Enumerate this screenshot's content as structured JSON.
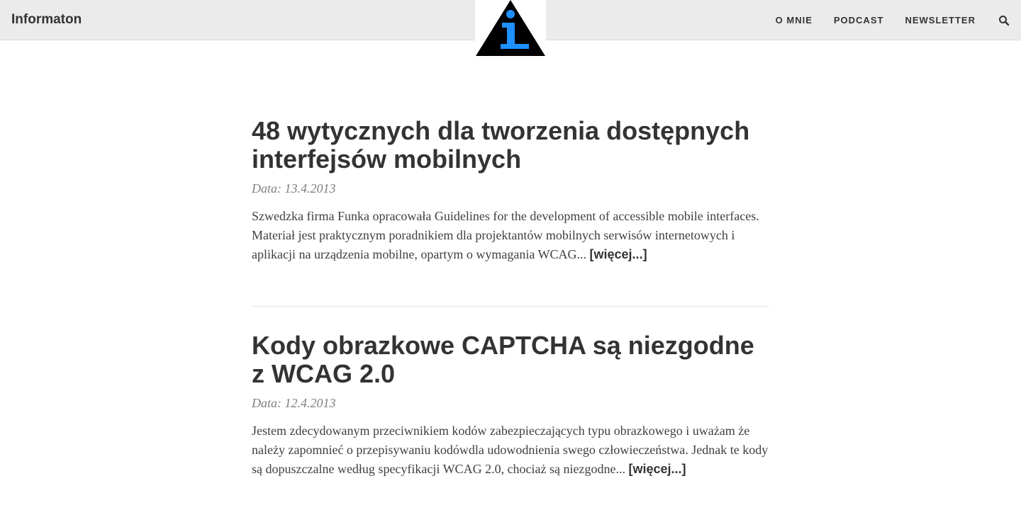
{
  "navbar": {
    "brand": "Informaton",
    "links": [
      "O MNIE",
      "PODCAST",
      "NEWSLETTER"
    ],
    "search_icon": "search-icon"
  },
  "logo": {
    "icon": "info-triangle-icon",
    "colors": {
      "triangle": "#000000",
      "letter": "#1e90ff"
    }
  },
  "posts": [
    {
      "title": "48 wytycznych dla tworzenia dostępnych interfejsów mobilnych",
      "date": "Data: 13.4.2013",
      "excerpt": "Szwedzka firma Funka opracowała Guidelines for the development of accessible mobile interfaces. Materiał jest praktycznym poradnikiem dla projektantów mobilnych serwisów internetowych i aplikacji na urządzenia mobilne, opartym o wymagania WCAG...",
      "more": "[więcej...]"
    },
    {
      "title": "Kody obrazkowe CAPTCHA są niezgodne z WCAG 2.0",
      "date": "Data: 12.4.2013",
      "excerpt": "Jestem zdecydowanym przeciwnikiem kodów zabezpieczających typu obrazkowego i uważam że należy zapomnieć o przepisywaniu kodówdla udowodnienia swego człowieczeństwa. Jednak te kody są dopuszczalne według specyfikacji WCAG 2.0, chociaż są niezgodne...",
      "more": "[więcej...]"
    }
  ]
}
